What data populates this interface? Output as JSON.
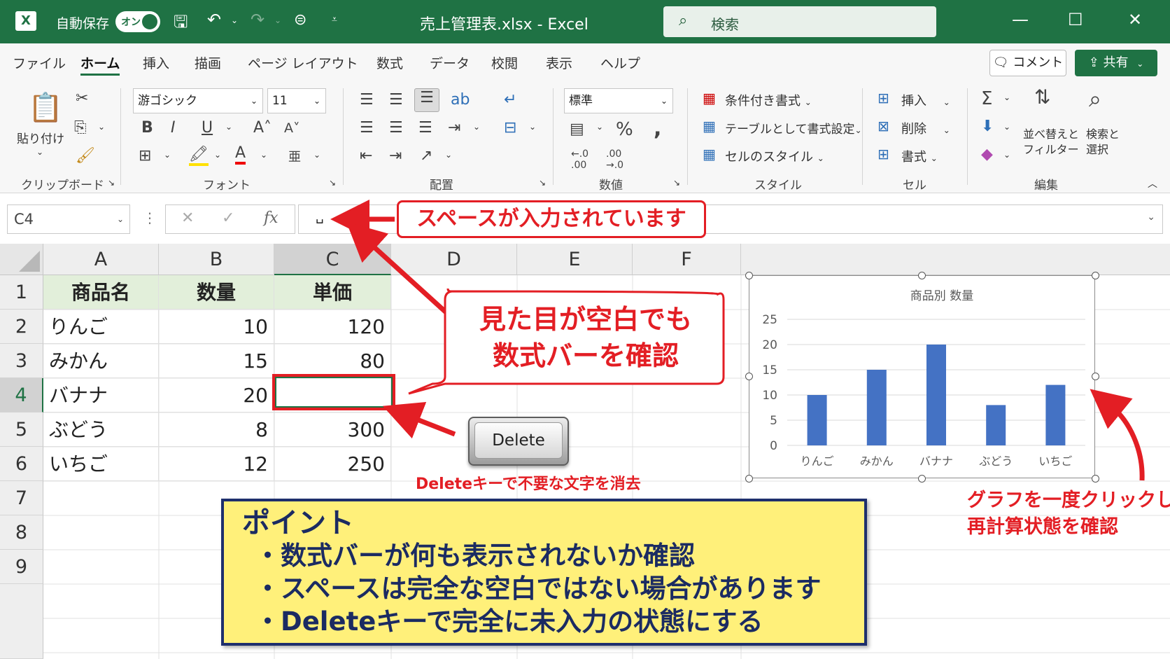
{
  "titlebar": {
    "logo": "X",
    "autosave_label": "自動保存",
    "autosave_state": "オン",
    "file_title": "売上管理表.xlsx  -  Excel",
    "search_placeholder": "検索",
    "icons": [
      "save-icon",
      "undo-icon",
      "redo-icon",
      "sync-icon",
      "customize-icon"
    ]
  },
  "menu": {
    "tabs": [
      "ファイル",
      "ホーム",
      "挿入",
      "描画",
      "ページ レイアウト",
      "数式",
      "データ",
      "校閲",
      "表示",
      "ヘルプ"
    ],
    "active_tab": "ホーム",
    "comment_label": "コメント",
    "share_label": "共有"
  },
  "ribbon": {
    "paste_label": "貼り付け",
    "font_name": "游ゴシック",
    "font_size": "11",
    "number_format": "標準",
    "conditional_format": "条件付き書式",
    "format_as_table": "テーブルとして書式設定",
    "cell_styles": "セルのスタイル",
    "insert": "挿入",
    "delete": "削除",
    "format": "書式",
    "sort_filter_1": "並べ替えと",
    "sort_filter_2": "フィルター",
    "find_select_1": "検索と",
    "find_select_2": "選択",
    "groups": [
      "クリップボード",
      "フォント",
      "配置",
      "数値",
      "スタイル",
      "セル",
      "編集"
    ]
  },
  "formula_bar": {
    "name_box": "C4",
    "value": "␣",
    "fx": "fx"
  },
  "sheet": {
    "columns": [
      "A",
      "B",
      "C",
      "D",
      "E",
      "F"
    ],
    "rows": [
      "1",
      "2",
      "3",
      "4",
      "5",
      "6",
      "7",
      "8",
      "9"
    ],
    "headers": [
      "商品名",
      "数量",
      "単価"
    ],
    "data": [
      [
        "りんご",
        "10",
        "120"
      ],
      [
        "みかん",
        "15",
        "80"
      ],
      [
        "バナナ",
        "20",
        ""
      ],
      [
        "ぶどう",
        "8",
        "300"
      ],
      [
        "いちご",
        "12",
        "250"
      ]
    ],
    "selected_cell": "C4"
  },
  "chart_data": {
    "type": "bar",
    "title": "商品別 数量",
    "categories": [
      "りんご",
      "みかん",
      "バナナ",
      "ぶどう",
      "いちご"
    ],
    "values": [
      10,
      15,
      20,
      8,
      12
    ],
    "ylim": [
      0,
      25
    ],
    "yticks": [
      0,
      5,
      10,
      15,
      20,
      25
    ],
    "grid": true,
    "bar_color": "#4472c4"
  },
  "annotations": {
    "space_entered": "スペースが入力されています",
    "bubble_line1": "見た目が空白でも",
    "bubble_line2": "数式バーを確認",
    "delete_key": "Delete",
    "delete_caption": "Deleteキーで不要な文字を消去",
    "chart_caption_1": "グラフを一度クリックして",
    "chart_caption_2": "再計算状態を確認",
    "point_title": "ポイント",
    "point_1": "・数式バーが何も表示されないか確認",
    "point_2": "・スペースは完全な空白ではない場合があります",
    "point_3": "・Deleteキーで完全に未入力の状態にする"
  },
  "colors": {
    "excel_green": "#1f7244",
    "annotation_red": "#e31e24",
    "point_box_bg": "#fff07a",
    "point_box_border": "#1e2f6d",
    "header_fill": "#e2efda"
  }
}
